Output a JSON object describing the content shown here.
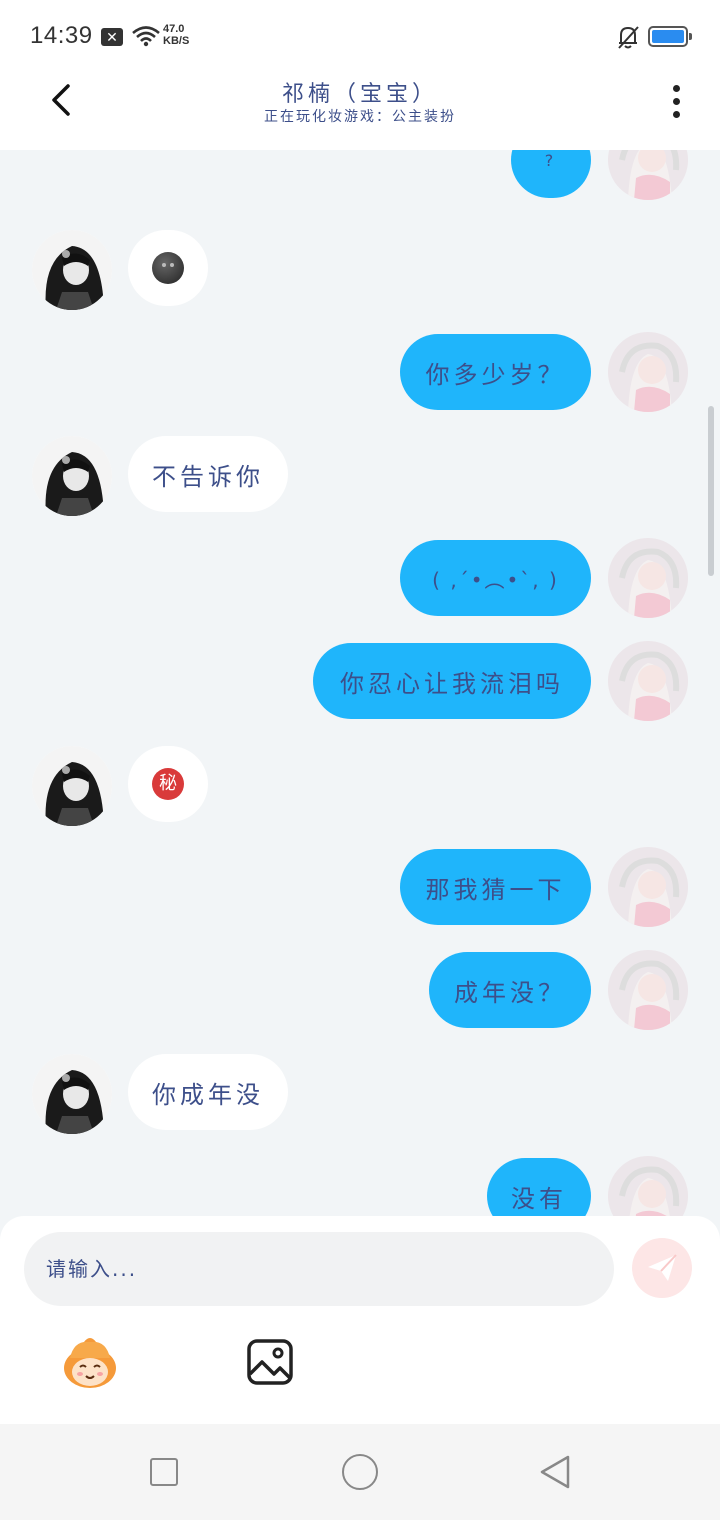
{
  "status_bar": {
    "time": "14:39",
    "network_speed_value": "47.0",
    "network_speed_unit": "KB/S"
  },
  "header": {
    "title": "祁楠（宝宝）",
    "subtitle": "正在玩化妆游戏：公主装扮"
  },
  "messages": [
    {
      "direction": "out",
      "text": "?"
    },
    {
      "direction": "in",
      "emoji": "new-moon-face-emoji"
    },
    {
      "direction": "out",
      "text": "你多少岁？"
    },
    {
      "direction": "in",
      "text": "不告诉你"
    },
    {
      "direction": "out",
      "text": "( ,´•︵•`, )"
    },
    {
      "direction": "out",
      "text": "你忍心让我流泪吗"
    },
    {
      "direction": "in",
      "emoji": "secret-emoji",
      "emoji_text": "秘"
    },
    {
      "direction": "out",
      "text": "那我猜一下"
    },
    {
      "direction": "out",
      "text": "成年没？"
    },
    {
      "direction": "in",
      "text": "你成年没"
    },
    {
      "direction": "out",
      "text": "没有"
    }
  ],
  "input": {
    "placeholder": "请输入..."
  },
  "colors": {
    "outgoing_bubble": "#1fb5fb",
    "incoming_bubble": "#ffffff",
    "text": "#3d4f8a",
    "background": "#f2f5f7"
  }
}
